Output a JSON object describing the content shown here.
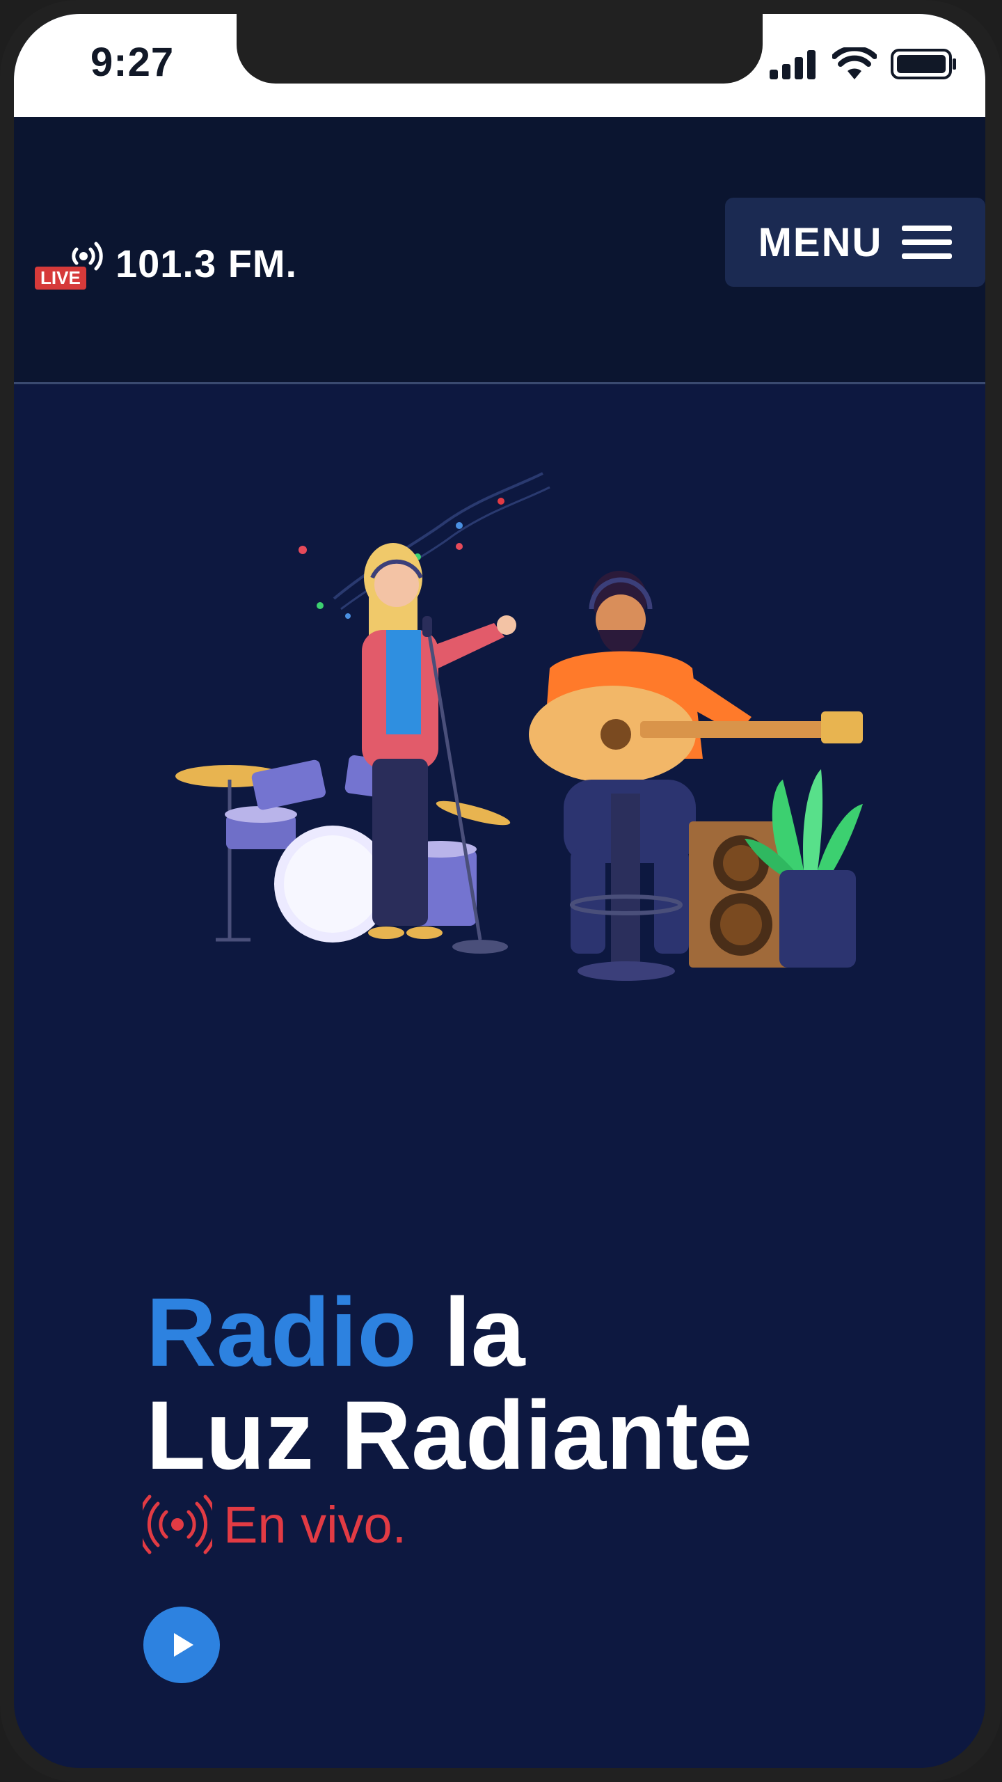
{
  "status_bar": {
    "time": "9:27",
    "icons": [
      "signal-icon",
      "wifi-icon",
      "battery-icon"
    ]
  },
  "header": {
    "logo_badge": "LIVE",
    "logo_text": "101.3 FM.",
    "menu_label": "MENU",
    "menu_icon": "hamburger-icon"
  },
  "hero": {
    "title_accent": "Radio",
    "title_rest": " la",
    "title_line2": "Luz Radiante",
    "live_label": "En vivo.",
    "live_icon": "broadcast-icon",
    "play_icon": "play-icon"
  },
  "colors": {
    "background": "#0d1840",
    "header_bg": "#0b1530",
    "accent_blue": "#2d82e0",
    "live_red": "#e23b44",
    "menu_bg": "#1b2a52"
  }
}
